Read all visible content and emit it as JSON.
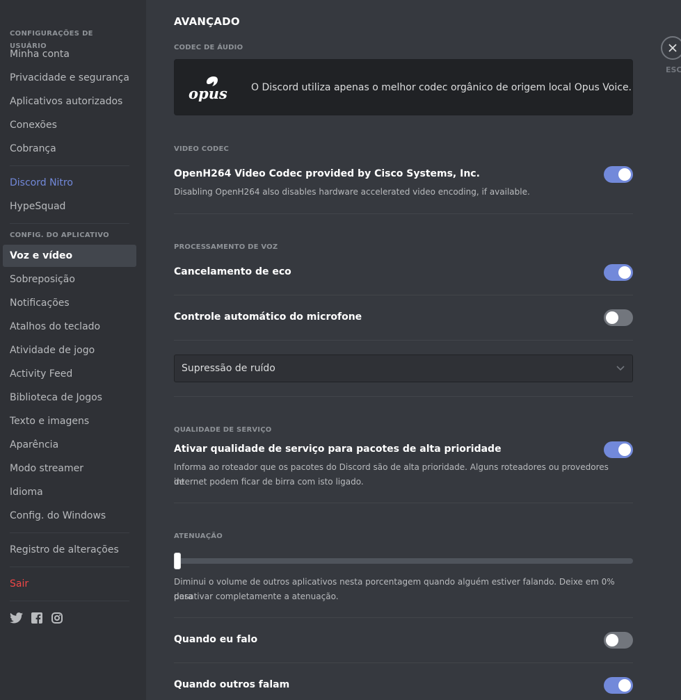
{
  "sidebar": {
    "user_settings_header": "CONFIGURAÇÕES DE USUÁRIO",
    "user_items": [
      "Minha conta",
      "Privacidade e segurança",
      "Aplicativos autorizados",
      "Conexões",
      "Cobrança"
    ],
    "nitro": "Discord Nitro",
    "hypesquad": "HypeSquad",
    "app_settings_header": "CONFIG. DO APLICATIVO",
    "app_items": [
      "Voz e vídeo",
      "Sobreposição",
      "Notificações",
      "Atalhos do teclado",
      "Atividade de jogo",
      "Activity Feed",
      "Biblioteca de Jogos",
      "Texto e imagens",
      "Aparência",
      "Modo streamer",
      "Idioma",
      "Config. do Windows"
    ],
    "selected_item": "Voz e vídeo",
    "changelog": "Registro de alterações",
    "logout": "Sair",
    "social_icons": [
      "twitter-icon",
      "facebook-icon",
      "instagram-icon"
    ]
  },
  "content": {
    "title": "AVANÇADO",
    "audio_codec": {
      "header": "CODEC DE ÁUDIO",
      "logo_text": "opus",
      "description": "O Discord utiliza apenas o melhor codec orgânico de origem local Opus Voice."
    },
    "video_codec": {
      "header": "VIDEO CODEC",
      "title": "OpenH264 Video Codec provided by Cisco Systems, Inc.",
      "description": "Disabling OpenH264 also disables hardware accelerated video encoding, if available.",
      "enabled": true
    },
    "voice_processing": {
      "header": "PROCESSAMENTO DE VOZ",
      "echo_cancellation": {
        "label": "Cancelamento de eco",
        "enabled": true
      },
      "auto_gain": {
        "label": "Controle automático do microfone",
        "enabled": false
      },
      "noise_select": {
        "value": "Supressão de ruído"
      }
    },
    "qos": {
      "header": "QUALIDADE DE SERVIÇO",
      "title": "Ativar qualidade de serviço para pacotes de alta prioridade",
      "description_line1": "Informa ao roteador que os pacotes do Discord são de alta prioridade. Alguns roteadores ou provedores de",
      "description_line2": "internet podem ficar de birra com isto ligado.",
      "enabled": true
    },
    "attenuation": {
      "header": "ATENUAÇÃO",
      "value_percent": 0,
      "description_line1": "Diminui o volume de outros aplicativos nesta porcentagem quando alguém estiver falando. Deixe em 0% para",
      "description_line2": "desativar completamente a atenuação.",
      "when_i_speak": {
        "label": "Quando eu falo",
        "enabled": false
      },
      "when_others_speak": {
        "label": "Quando outros falam",
        "enabled": true
      }
    }
  },
  "close": {
    "label": "ESC"
  },
  "colors": {
    "accent": "#7289da",
    "danger": "#f04747",
    "toggle_off": "#72767d"
  }
}
